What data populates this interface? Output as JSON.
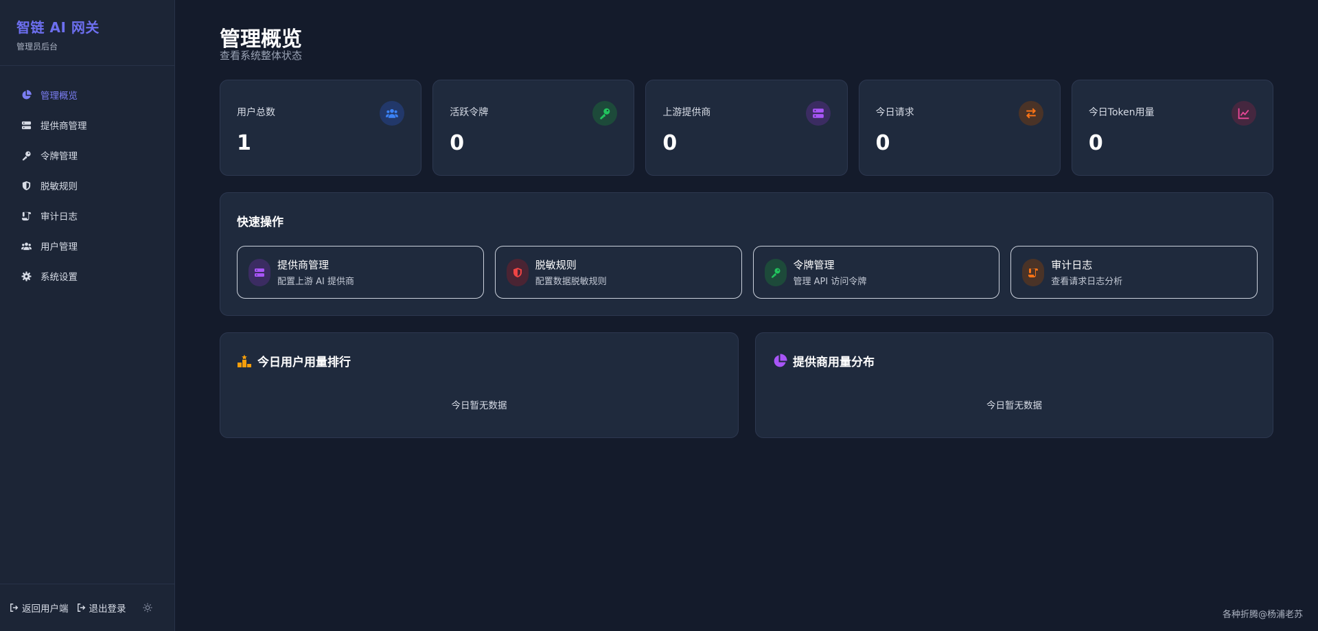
{
  "brand": {
    "title": "智链 AI 网关",
    "subtitle": "管理员后台"
  },
  "sidebar": {
    "items": [
      {
        "label": "管理概览",
        "icon": "pie-chart-icon"
      },
      {
        "label": "提供商管理",
        "icon": "server-icon"
      },
      {
        "label": "令牌管理",
        "icon": "key-icon"
      },
      {
        "label": "脱敏规则",
        "icon": "shield-icon"
      },
      {
        "label": "审计日志",
        "icon": "scroll-icon"
      },
      {
        "label": "用户管理",
        "icon": "users-icon"
      },
      {
        "label": "系统设置",
        "icon": "gear-icon"
      }
    ],
    "footer": {
      "back_label": "返回用户端",
      "logout_label": "退出登录"
    }
  },
  "header": {
    "title": "管理概览",
    "subtitle": "查看系统整体状态"
  },
  "stats": [
    {
      "label": "用户总数",
      "value": "1",
      "icon": "users-icon",
      "color": "#3b82f6"
    },
    {
      "label": "活跃令牌",
      "value": "0",
      "icon": "key-icon",
      "color": "#22c55e"
    },
    {
      "label": "上游提供商",
      "value": "0",
      "icon": "server-icon",
      "color": "#a855f7"
    },
    {
      "label": "今日请求",
      "value": "0",
      "icon": "exchange-icon",
      "color": "#f97316"
    },
    {
      "label": "今日Token用量",
      "value": "0",
      "icon": "line-chart-icon",
      "color": "#ec4899"
    }
  ],
  "quick": {
    "title": "快速操作",
    "actions": [
      {
        "title": "提供商管理",
        "desc": "配置上游 AI 提供商",
        "icon": "server-icon",
        "color": "#a855f7"
      },
      {
        "title": "脱敏规则",
        "desc": "配置数据脱敏规则",
        "icon": "shield-icon",
        "color": "#ef4444"
      },
      {
        "title": "令牌管理",
        "desc": "管理 API 访问令牌",
        "icon": "key-icon",
        "color": "#22c55e"
      },
      {
        "title": "审计日志",
        "desc": "查看请求日志分析",
        "icon": "scroll-icon",
        "color": "#f97316"
      }
    ]
  },
  "ranking": {
    "title": "今日用户用量排行",
    "empty": "今日暂无数据",
    "icon": "ranking-icon",
    "color": "#f59e0b"
  },
  "distribution": {
    "title": "提供商用量分布",
    "empty": "今日暂无数据",
    "icon": "pie-chart-icon",
    "color": "#a855f7"
  },
  "watermark": "各种折腾@杨浦老苏"
}
